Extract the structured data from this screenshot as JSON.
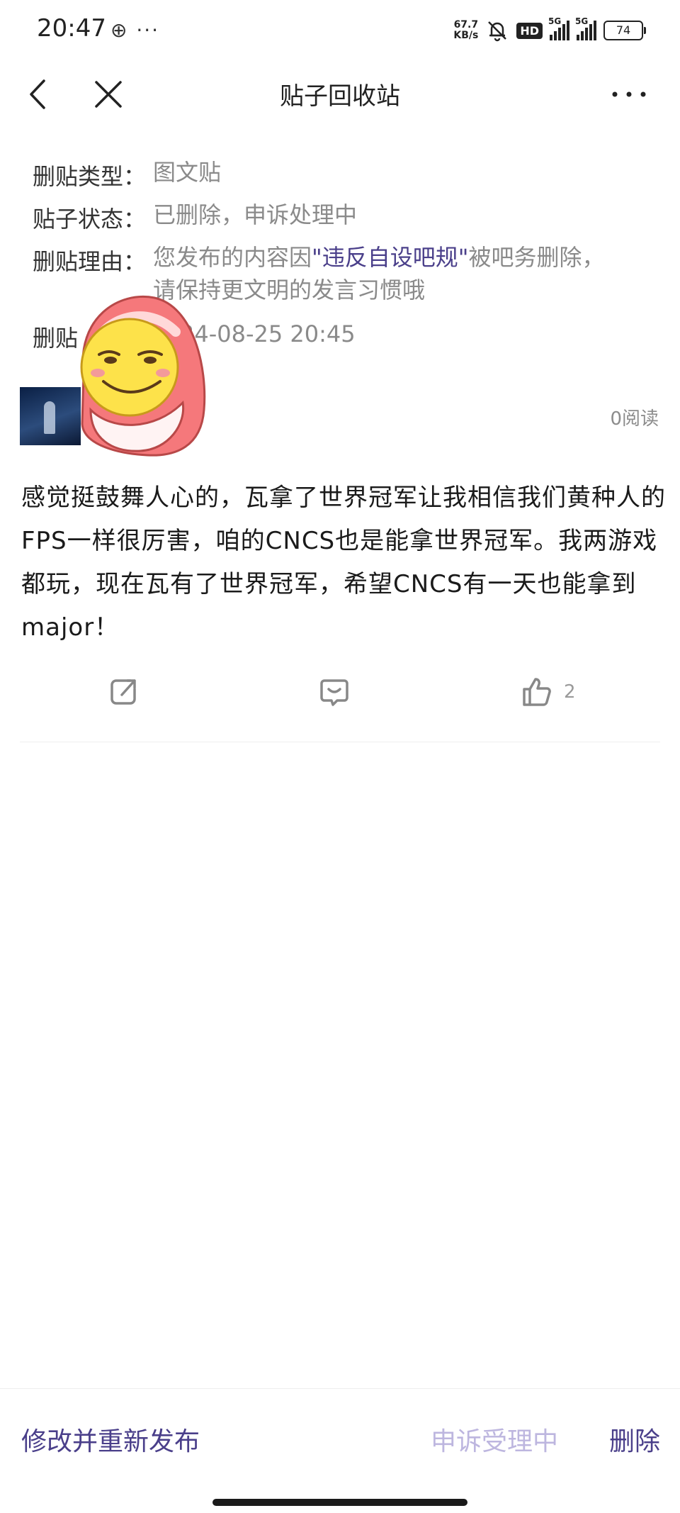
{
  "status_bar": {
    "time": "20:47",
    "left_icons": "⊕ ···",
    "net_speed_value": "67.7",
    "net_speed_unit": "KB/s",
    "hd_label": "HD",
    "signal_1_label": "5G",
    "signal_2_label": "5G",
    "battery": "74"
  },
  "header": {
    "title": "贴子回收站"
  },
  "info": {
    "type_label": "删贴类型：",
    "type_value": "图文贴",
    "status_label": "贴子状态：",
    "status_value": "已删除，申诉处理中",
    "reason_label": "删贴理由：",
    "reason_prefix": "您发布的内容因",
    "reason_highlight": "\"违反自设吧规\"",
    "reason_suffix": "被吧务删除，",
    "reason_line2": "请保持更文明的发言习惯哦",
    "time_label": "删贴",
    "time_value": "24-08-25 20:45"
  },
  "post": {
    "read_count": "0阅读",
    "content": "感觉挺鼓舞人心的，瓦拿了世界冠军让我相信我们黄种人的FPS一样很厉害，咱的CNCS也是能拿世界冠军。我两游戏都玩，现在瓦有了世界冠军，希望CNCS有一天也能拿到major！",
    "like_count": "2"
  },
  "icons": {
    "share": "share-icon",
    "comment": "comment-icon",
    "like": "thumbs-up-icon"
  },
  "footer": {
    "republish": "修改并重新发布",
    "appeal": "申诉受理中",
    "delete": "删除"
  },
  "colors": {
    "accent": "#4a3f8a",
    "accent_disabled": "#bdb6df",
    "secondary_text": "#8a8a8a"
  }
}
